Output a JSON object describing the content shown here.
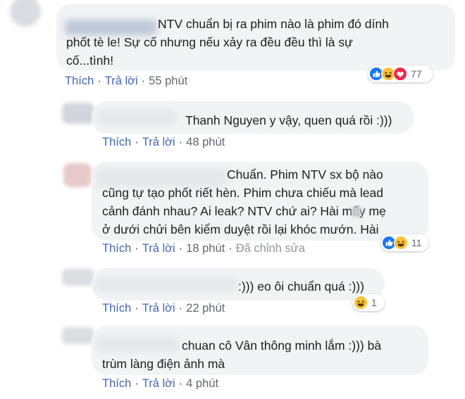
{
  "comments": [
    {
      "text": "NTV chuẩn bị ra phim nào là phim đó dính\nphốt tè le! Sự cố nhưng nếu xảy ra đều đều thì là sự\ncố...tình!",
      "like": "Thích",
      "reply": "Trả lời",
      "time": "55 phút",
      "reactions": [
        "like-icon",
        "haha-icon",
        "love-icon"
      ],
      "reaction_count": "77"
    },
    {
      "text": "Thanh Nguyen y vậy, quen quá rồi :)))",
      "like": "Thích",
      "reply": "Trả lời",
      "time": "48 phút"
    },
    {
      "text": "Chuẩn. Phim NTV sx bộ nào\ncũng tự tạo phốt riết hèn. Phim chưa chiếu mà lead\ncảnh đánh nhau? Ai leak? NTV chứ ai? Hài     mấy mẹ\nở dưới chửi bên kiểm duyệt rồi lại khóc mướn. Hài",
      "like": "Thích",
      "reply": "Trả lời",
      "time": "18 phút",
      "edited": "Đã chỉnh sửa",
      "reactions": [
        "like-icon",
        "haha-icon"
      ],
      "reaction_count": "11"
    },
    {
      "text": ":))) eo ôi chuẩn quá :)))",
      "like": "Thích",
      "reply": "Trả lời",
      "time": "22 phút",
      "reactions": [
        "haha-icon"
      ],
      "reaction_count": "1"
    },
    {
      "text": "chuan cô Vân thông minh lắm :))) bà\ntrùm làng điện ảnh mà",
      "like": "Thích",
      "reply": "Trả lời",
      "time": "4 phút"
    }
  ],
  "colors": {
    "link": "#4267b2",
    "bubble": "#f2f3f5",
    "like": "#1877f2",
    "haha": "#f7c23c",
    "love": "#f0284a"
  }
}
